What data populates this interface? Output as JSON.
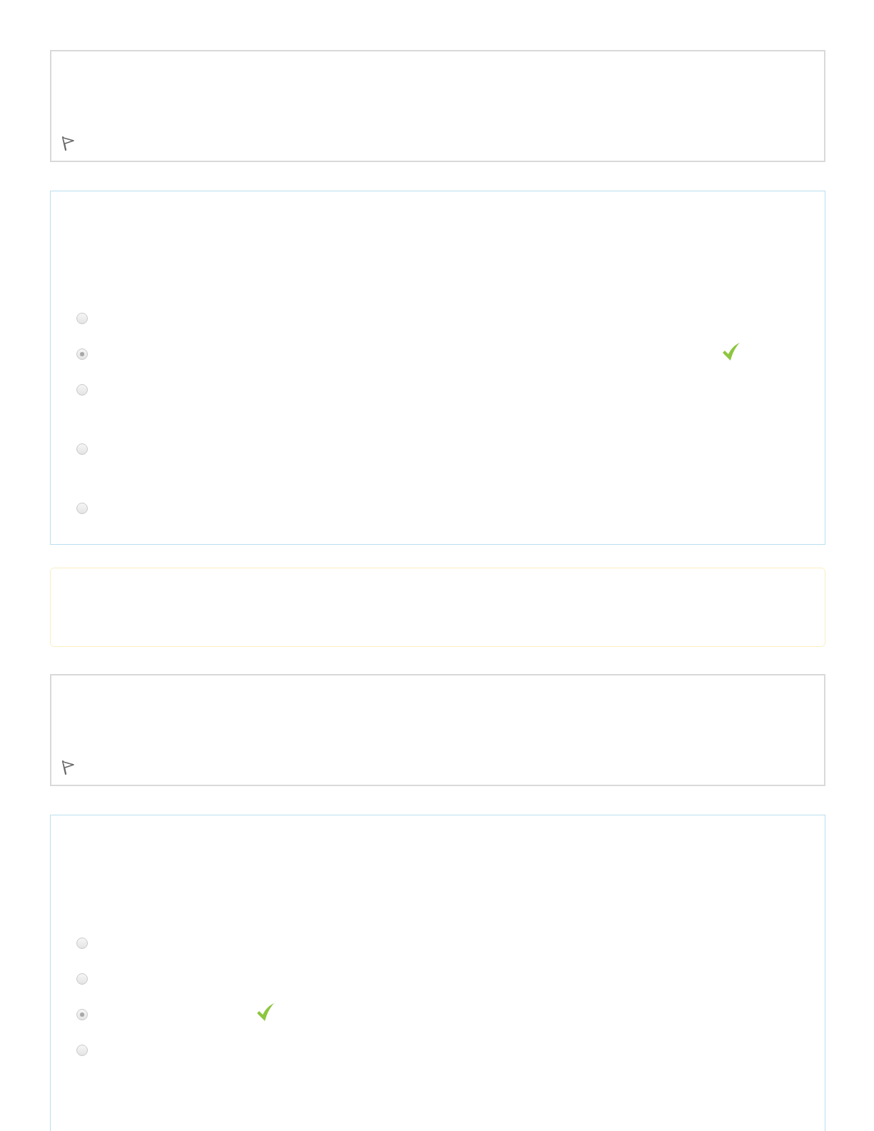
{
  "sections": [
    {
      "kind": "info"
    },
    {
      "kind": "question",
      "options": [
        {
          "selected": false,
          "correct": false
        },
        {
          "selected": true,
          "correct": true
        },
        {
          "selected": false,
          "correct": false
        },
        {
          "selected": false,
          "correct": false
        },
        {
          "selected": false,
          "correct": false
        }
      ]
    },
    {
      "kind": "feedback"
    },
    {
      "kind": "info"
    },
    {
      "kind": "question",
      "options": [
        {
          "selected": false,
          "correct": false
        },
        {
          "selected": false,
          "correct": false
        },
        {
          "selected": true,
          "correct": true
        },
        {
          "selected": false,
          "correct": false
        }
      ]
    }
  ]
}
